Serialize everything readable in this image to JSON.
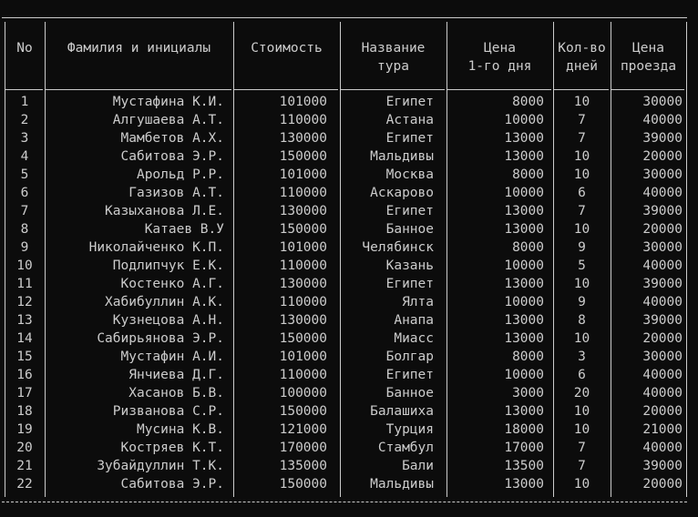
{
  "headers": {
    "no": [
      "No"
    ],
    "name": [
      "Фамилия и инициалы"
    ],
    "cost": [
      "Стоимость"
    ],
    "tour": [
      "Название",
      "тура"
    ],
    "price": [
      "Цена",
      "1-го дня"
    ],
    "days": [
      "Кол-во",
      "дней"
    ],
    "travel": [
      "Цена",
      "проезда"
    ]
  },
  "rows": [
    {
      "no": "1",
      "name": "Мустафина К.И.",
      "cost": "101000",
      "tour": "Египет",
      "price": "8000",
      "days": "10",
      "travel": "30000"
    },
    {
      "no": "2",
      "name": "Алгушаева А.Т.",
      "cost": "110000",
      "tour": "Астана",
      "price": "10000",
      "days": "7",
      "travel": "40000"
    },
    {
      "no": "3",
      "name": "Мамбетов А.Х.",
      "cost": "130000",
      "tour": "Египет",
      "price": "13000",
      "days": "7",
      "travel": "39000"
    },
    {
      "no": "4",
      "name": "Сабитова Э.Р.",
      "cost": "150000",
      "tour": "Мальдивы",
      "price": "13000",
      "days": "10",
      "travel": "20000"
    },
    {
      "no": "5",
      "name": "Арольд Р.Р.",
      "cost": "101000",
      "tour": "Москва",
      "price": "8000",
      "days": "10",
      "travel": "30000"
    },
    {
      "no": "6",
      "name": "Газизов А.Т.",
      "cost": "110000",
      "tour": "Аскарово",
      "price": "10000",
      "days": "6",
      "travel": "40000"
    },
    {
      "no": "7",
      "name": "Казыханова Л.Е.",
      "cost": "130000",
      "tour": "Египет",
      "price": "13000",
      "days": "7",
      "travel": "39000"
    },
    {
      "no": "8",
      "name": "Катаев В.У",
      "cost": "150000",
      "tour": "Банное",
      "price": "13000",
      "days": "10",
      "travel": "20000"
    },
    {
      "no": "9",
      "name": "Николайченко К.П.",
      "cost": "101000",
      "tour": "Челябинск",
      "price": "8000",
      "days": "9",
      "travel": "30000"
    },
    {
      "no": "10",
      "name": "Подлипчук Е.К.",
      "cost": "110000",
      "tour": "Казань",
      "price": "10000",
      "days": "5",
      "travel": "40000"
    },
    {
      "no": "11",
      "name": "Костенко А.Г.",
      "cost": "130000",
      "tour": "Египет",
      "price": "13000",
      "days": "10",
      "travel": "39000"
    },
    {
      "no": "12",
      "name": "Хабибуллин А.К.",
      "cost": "110000",
      "tour": "Ялта",
      "price": "10000",
      "days": "9",
      "travel": "40000"
    },
    {
      "no": "13",
      "name": "Кузнецова А.Н.",
      "cost": "130000",
      "tour": "Анапа",
      "price": "13000",
      "days": "8",
      "travel": "39000"
    },
    {
      "no": "14",
      "name": "Сабирьянова Э.Р.",
      "cost": "150000",
      "tour": "Миасс",
      "price": "13000",
      "days": "10",
      "travel": "20000"
    },
    {
      "no": "15",
      "name": "Мустафин А.И.",
      "cost": "101000",
      "tour": "Болгар",
      "price": "8000",
      "days": "3",
      "travel": "30000"
    },
    {
      "no": "16",
      "name": "Янчиева Д.Г.",
      "cost": "110000",
      "tour": "Египет",
      "price": "10000",
      "days": "6",
      "travel": "40000"
    },
    {
      "no": "17",
      "name": "Хасанов Б.В.",
      "cost": "100000",
      "tour": "Банное",
      "price": "3000",
      "days": "20",
      "travel": "40000"
    },
    {
      "no": "18",
      "name": "Ризванова С.Р.",
      "cost": "150000",
      "tour": "Балашиха",
      "price": "13000",
      "days": "10",
      "travel": "20000"
    },
    {
      "no": "19",
      "name": "Мусина К.В.",
      "cost": "121000",
      "tour": "Турция",
      "price": "18000",
      "days": "10",
      "travel": "21000"
    },
    {
      "no": "20",
      "name": "Костряев К.Т.",
      "cost": "170000",
      "tour": "Стамбул",
      "price": "17000",
      "days": "7",
      "travel": "40000"
    },
    {
      "no": "21",
      "name": "Зубайдуллин Т.К.",
      "cost": "135000",
      "tour": "Бали",
      "price": "13500",
      "days": "7",
      "travel": "39000"
    },
    {
      "no": "22",
      "name": "Сабитова Э.Р.",
      "cost": "150000",
      "tour": "Мальдивы",
      "price": "13000",
      "days": "10",
      "travel": "20000"
    }
  ]
}
